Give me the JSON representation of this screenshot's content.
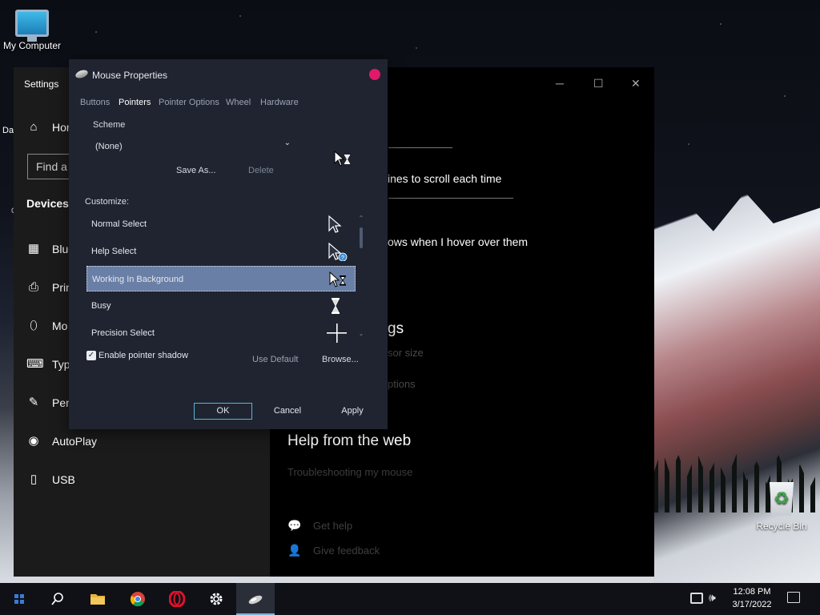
{
  "desktop": {
    "my_computer": "My Computer",
    "recycle_bin": "Recycle Bin"
  },
  "settings": {
    "title": "Settings",
    "home": "Hor",
    "search_placeholder": "Find a",
    "section": "Devices",
    "items": [
      "Blue",
      "Prin",
      "Mo",
      "Typ",
      "Pen",
      "AutoPlay",
      "USB"
    ],
    "main_text": [
      "ines to scroll each time",
      "ows when I hover over them"
    ],
    "related_heading_fragment": "gs",
    "related_link_1": "sor size",
    "related_link_2": "ptions",
    "help_heading": "Help from the web",
    "help_link": "Troubleshooting my mouse",
    "get_help": "Get help",
    "give_feedback": "Give feedback",
    "desk_fragment_1": "Da",
    "desk_fragment_2": "C"
  },
  "dialog": {
    "title": "Mouse Properties",
    "tabs": [
      "Buttons",
      "Pointers",
      "Pointer Options",
      "Wheel",
      "Hardware"
    ],
    "active_tab": "Pointers",
    "scheme_label": "Scheme",
    "scheme_value": "(None)",
    "save_as": "Save As...",
    "delete": "Delete",
    "customize_label": "Customize:",
    "cursors": [
      {
        "label": "Normal Select",
        "icon": "arrow-cursor-icon"
      },
      {
        "label": "Help Select",
        "icon": "help-cursor-icon"
      },
      {
        "label": "Working In Background",
        "icon": "working-cursor-icon",
        "selected": true
      },
      {
        "label": "Busy",
        "icon": "hourglass-cursor-icon"
      },
      {
        "label": "Precision Select",
        "icon": "crosshair-cursor-icon"
      }
    ],
    "enable_shadow": "Enable pointer shadow",
    "shadow_checked": true,
    "use_default": "Use Default",
    "browse": "Browse...",
    "ok": "OK",
    "cancel": "Cancel",
    "apply": "Apply"
  },
  "taskbar": {
    "time": "12:08 PM",
    "date": "3/17/2022",
    "apps": [
      "start-icon",
      "search-icon",
      "file-explorer-icon",
      "chrome-icon",
      "opera-icon",
      "settings-gear-icon",
      "mouse-properties-icon"
    ]
  },
  "colors": {
    "dialog_bg": "#1f2430",
    "selection": "#6a7fa6",
    "close_button": "#e0196a",
    "ok_border": "#56b6d6"
  }
}
